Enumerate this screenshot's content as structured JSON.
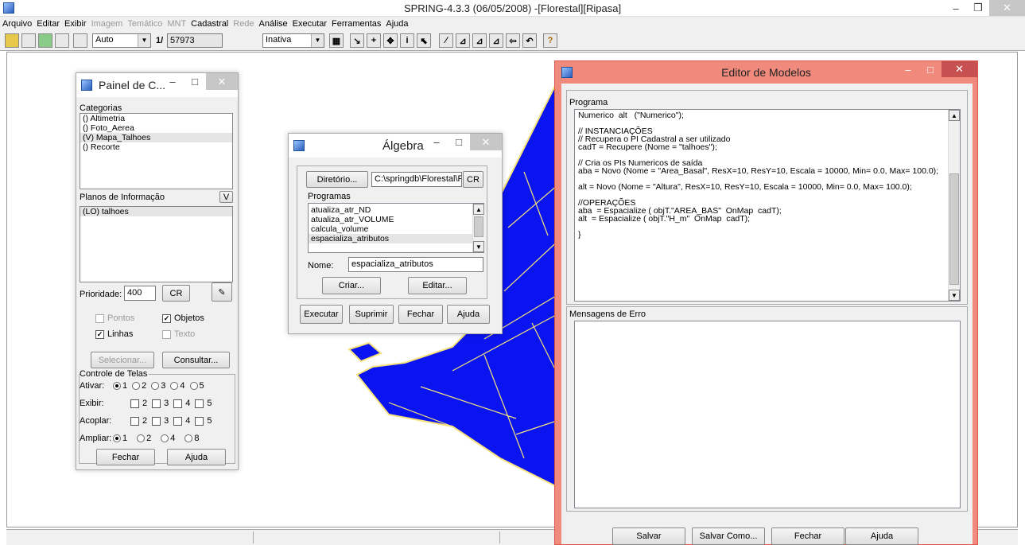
{
  "app": {
    "title": "SPRING-4.3.3 (06/05/2008) -[Florestal][Ripasa]"
  },
  "menu": [
    "Arquivo",
    "Editar",
    "Exibir",
    "Imagem",
    "Temático",
    "MNT",
    "Cadastral",
    "Rede",
    "Análise",
    "Executar",
    "Ferramentas",
    "Ajuda"
  ],
  "menu_disabled": [
    "Imagem",
    "Temático",
    "MNT",
    "Rede"
  ],
  "toolbar": {
    "zoom_mode": "Auto",
    "scale_prefix": "1/",
    "scale_value": "57973",
    "status_combo": "Inativa",
    "help_glyph": "?"
  },
  "painel": {
    "title": "Painel de C...",
    "categorias_label": "Categorias",
    "categorias": [
      "() Altimetria",
      "() Foto_Aerea",
      "(V) Mapa_Talhoes",
      "() Recorte"
    ],
    "categorias_selected": 2,
    "planos_label": "Planos de Informação",
    "planos_btn": "V",
    "planos": [
      "(LO) talhoes"
    ],
    "prioridade_label": "Prioridade:",
    "prioridade_value": "400",
    "cr_label": "CR",
    "chk_pontos": "Pontos",
    "chk_objetos": "Objetos",
    "chk_linhas": "Linhas",
    "chk_texto": "Texto",
    "selecionar": "Selecionar...",
    "consultar": "Consultar...",
    "controle_label": "Controle de Telas",
    "ativar_label": "Ativar:",
    "exibir_label": "Exibir:",
    "acoplar_label": "Acoplar:",
    "ampliar_label": "Ampliar:",
    "n1": "1",
    "n2": "2",
    "n3": "3",
    "n4": "4",
    "n5": "5",
    "n8": "8",
    "fechar": "Fechar",
    "ajuda": "Ajuda"
  },
  "algebra": {
    "title": "Álgebra",
    "diretorio_btn": "Diretório...",
    "diretorio_path": "C:\\springdb\\Florestal\\P",
    "cr": "CR",
    "programas_label": "Programas",
    "programas": [
      "atualiza_atr_ND",
      "atualiza_atr_VOLUME",
      "calcula_volume",
      "espacializa_atributos"
    ],
    "programas_selected": 3,
    "nome_label": "Nome:",
    "nome_value": "espacializa_atributos",
    "criar": "Criar...",
    "editar": "Editar...",
    "executar": "Executar",
    "suprimir": "Suprimir",
    "fechar": "Fechar",
    "ajuda": "Ajuda"
  },
  "editor": {
    "title": "Editor de Modelos",
    "programa_label": "Programa",
    "code_lines": [
      "Numerico  alt   (\"Numerico\");",
      "",
      "// INSTANCIAÇÕES",
      "// Recupera o PI Cadastral a ser utilizado",
      "cadT = Recupere (Nome = \"talhoes\");",
      "",
      "// Cria os PIs Numericos de saída",
      "aba = Novo (Nome = \"Area_Basal\", ResX=10, ResY=10, Escala = 10000, Min= 0.0, Max= 100.0);",
      "",
      "alt = Novo (Nome = \"Altura\", ResX=10, ResY=10, Escala = 10000, Min= 0.0, Max= 100.0);",
      "",
      "//OPERAÇÕES",
      "aba  = Espacialize ( objT.\"AREA_BAS\"  OnMap  cadT);",
      "alt  = Espacialize ( objT.\"H_m\"  OnMap  cadT);",
      "",
      "}"
    ],
    "erro_label": "Mensagens de Erro",
    "salvar": "Salvar",
    "salvar_como": "Salvar Como...",
    "fechar": "Fechar",
    "ajuda": "Ajuda"
  },
  "colors": {
    "map_fill": "#0a14f0",
    "map_outline": "#f5e27a",
    "editor_frame": "#f08a7c"
  }
}
